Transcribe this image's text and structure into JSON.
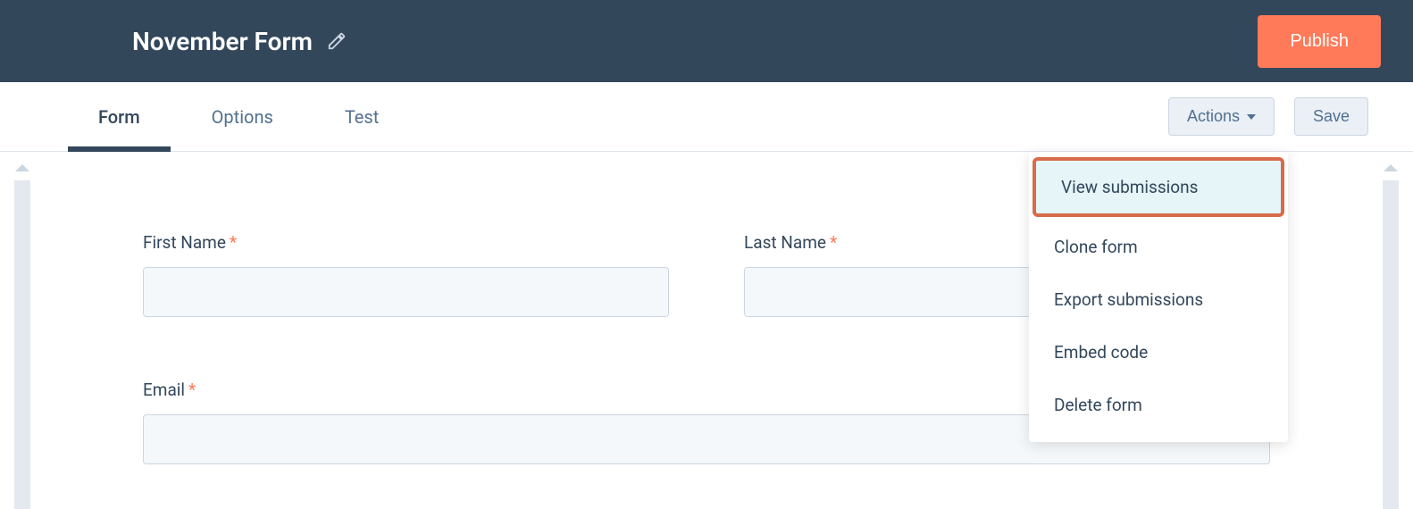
{
  "header": {
    "title": "November Form",
    "publish": "Publish"
  },
  "tabs": {
    "items": [
      {
        "label": "Form",
        "active": true
      },
      {
        "label": "Options",
        "active": false
      },
      {
        "label": "Test",
        "active": false
      }
    ]
  },
  "buttons": {
    "actions": "Actions",
    "save": "Save"
  },
  "actions_menu": [
    {
      "label": "View submissions",
      "highlight": true
    },
    {
      "label": "Clone form",
      "highlight": false
    },
    {
      "label": "Export submissions",
      "highlight": false
    },
    {
      "label": "Embed code",
      "highlight": false
    },
    {
      "label": "Delete form",
      "highlight": false
    }
  ],
  "form": {
    "fields": {
      "first_name": {
        "label": "First Name",
        "required": true
      },
      "last_name": {
        "label": "Last Name",
        "required": true
      },
      "email": {
        "label": "Email",
        "required": true
      }
    }
  }
}
